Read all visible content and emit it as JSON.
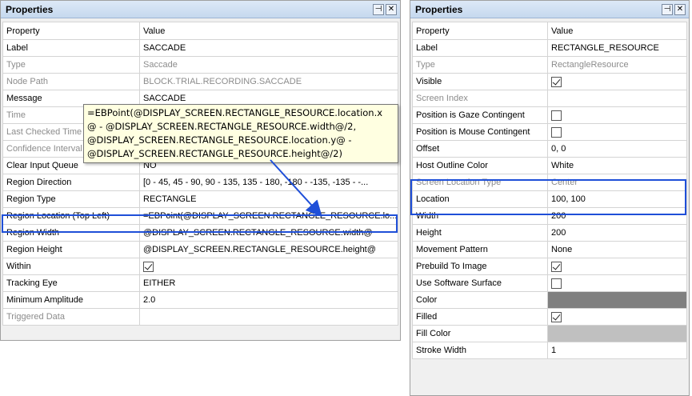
{
  "left_panel": {
    "title": "Properties",
    "pin_glyph": "⊣",
    "close_glyph": "✕",
    "header": {
      "property": "Property",
      "value": "Value"
    },
    "rows": [
      {
        "property": "Label",
        "value": "SACCADE",
        "kind": "text",
        "dim": false
      },
      {
        "property": "Type",
        "value": "Saccade",
        "kind": "text",
        "dim": true
      },
      {
        "property": "Node Path",
        "value": "BLOCK.TRIAL.RECORDING.SACCADE",
        "kind": "text",
        "dim": true
      },
      {
        "property": "Message",
        "value": "SACCADE",
        "kind": "text",
        "dim": false
      },
      {
        "property": "Time",
        "value": "",
        "kind": "text",
        "dim": true
      },
      {
        "property": "Last Checked Time",
        "value": "",
        "kind": "text",
        "dim": true
      },
      {
        "property": "Confidence Interval",
        "value": "",
        "kind": "text",
        "dim": true
      },
      {
        "property": "Clear Input Queue",
        "value": "NO",
        "kind": "text",
        "dim": false
      },
      {
        "property": "Region Direction",
        "value": "[0 - 45, 45 - 90, 90 - 135, 135 - 180, -180 - -135, -135 - -...",
        "kind": "text",
        "dim": false
      },
      {
        "property": "Region Type",
        "value": "RECTANGLE",
        "kind": "text",
        "dim": false
      },
      {
        "property": "Region Location (Top Left)",
        "value": "=EBPoint(@DISPLAY_SCREEN.RECTANGLE_RESOURCE.lo...",
        "kind": "text",
        "dim": false
      },
      {
        "property": "Region Width",
        "value": "@DISPLAY_SCREEN.RECTANGLE_RESOURCE.width@",
        "kind": "text",
        "dim": false
      },
      {
        "property": "Region Height",
        "value": "@DISPLAY_SCREEN.RECTANGLE_RESOURCE.height@",
        "kind": "text",
        "dim": false
      },
      {
        "property": "Within",
        "value": "",
        "kind": "check",
        "checked": true,
        "dim": false
      },
      {
        "property": "Tracking Eye",
        "value": "EITHER",
        "kind": "text",
        "dim": false
      },
      {
        "property": "Minimum Amplitude",
        "value": "2.0",
        "kind": "text",
        "dim": false
      },
      {
        "property": "Triggered Data",
        "value": "",
        "kind": "text",
        "dim": true
      }
    ],
    "tooltip_lines": [
      "=EBPoint(@DISPLAY_SCREEN.RECTANGLE_RESOURCE.location.x",
      "@ - @DISPLAY_SCREEN.RECTANGLE_RESOURCE.width@/2,",
      "@DISPLAY_SCREEN.RECTANGLE_RESOURCE.location.y@ -",
      "@DISPLAY_SCREEN.RECTANGLE_RESOURCE.height@/2)"
    ]
  },
  "right_panel": {
    "title": "Properties",
    "pin_glyph": "⊣",
    "close_glyph": "✕",
    "header": {
      "property": "Property",
      "value": "Value"
    },
    "rows": [
      {
        "property": "Label",
        "value": "RECTANGLE_RESOURCE",
        "kind": "text",
        "dim": false
      },
      {
        "property": "Type",
        "value": "RectangleResource",
        "kind": "text",
        "dim": true
      },
      {
        "property": "Visible",
        "value": "",
        "kind": "check",
        "checked": true,
        "dim": false
      },
      {
        "property": "Screen Index",
        "value": "",
        "kind": "text",
        "dim": true
      },
      {
        "property": "Position is Gaze Contingent",
        "value": "",
        "kind": "check",
        "checked": false,
        "dim": false
      },
      {
        "property": "Position is Mouse Contingent",
        "value": "",
        "kind": "check",
        "checked": false,
        "dim": false
      },
      {
        "property": "Offset",
        "value": "0, 0",
        "kind": "text",
        "dim": false
      },
      {
        "property": "Host Outline Color",
        "value": "White",
        "kind": "text",
        "dim": false
      },
      {
        "property": "Screen Location Type",
        "value": "Center",
        "kind": "text",
        "dim": true
      },
      {
        "property": "Location",
        "value": "100, 100",
        "kind": "text",
        "dim": false
      },
      {
        "property": "Width",
        "value": "200",
        "kind": "text",
        "dim": false
      },
      {
        "property": "Height",
        "value": "200",
        "kind": "text",
        "dim": false
      },
      {
        "property": "Movement Pattern",
        "value": "None",
        "kind": "text",
        "dim": false
      },
      {
        "property": "Prebuild To Image",
        "value": "",
        "kind": "check",
        "checked": true,
        "dim": false
      },
      {
        "property": "Use Software Surface",
        "value": "",
        "kind": "check",
        "checked": false,
        "dim": false
      },
      {
        "property": "Color",
        "value": "",
        "kind": "swatch",
        "color": "#808080",
        "dim": false
      },
      {
        "property": "Filled",
        "value": "",
        "kind": "check",
        "checked": true,
        "dim": false
      },
      {
        "property": "Fill Color",
        "value": "",
        "kind": "swatch",
        "color": "#c0c0c0",
        "dim": false
      },
      {
        "property": "Stroke Width",
        "value": "1",
        "kind": "text",
        "dim": false
      }
    ]
  },
  "colors": {
    "highlight": "#1f4fd8",
    "arrow": "#1f4fd8",
    "tooltip_bg": "#ffffe1",
    "dim_text": "#8c8c8c"
  }
}
